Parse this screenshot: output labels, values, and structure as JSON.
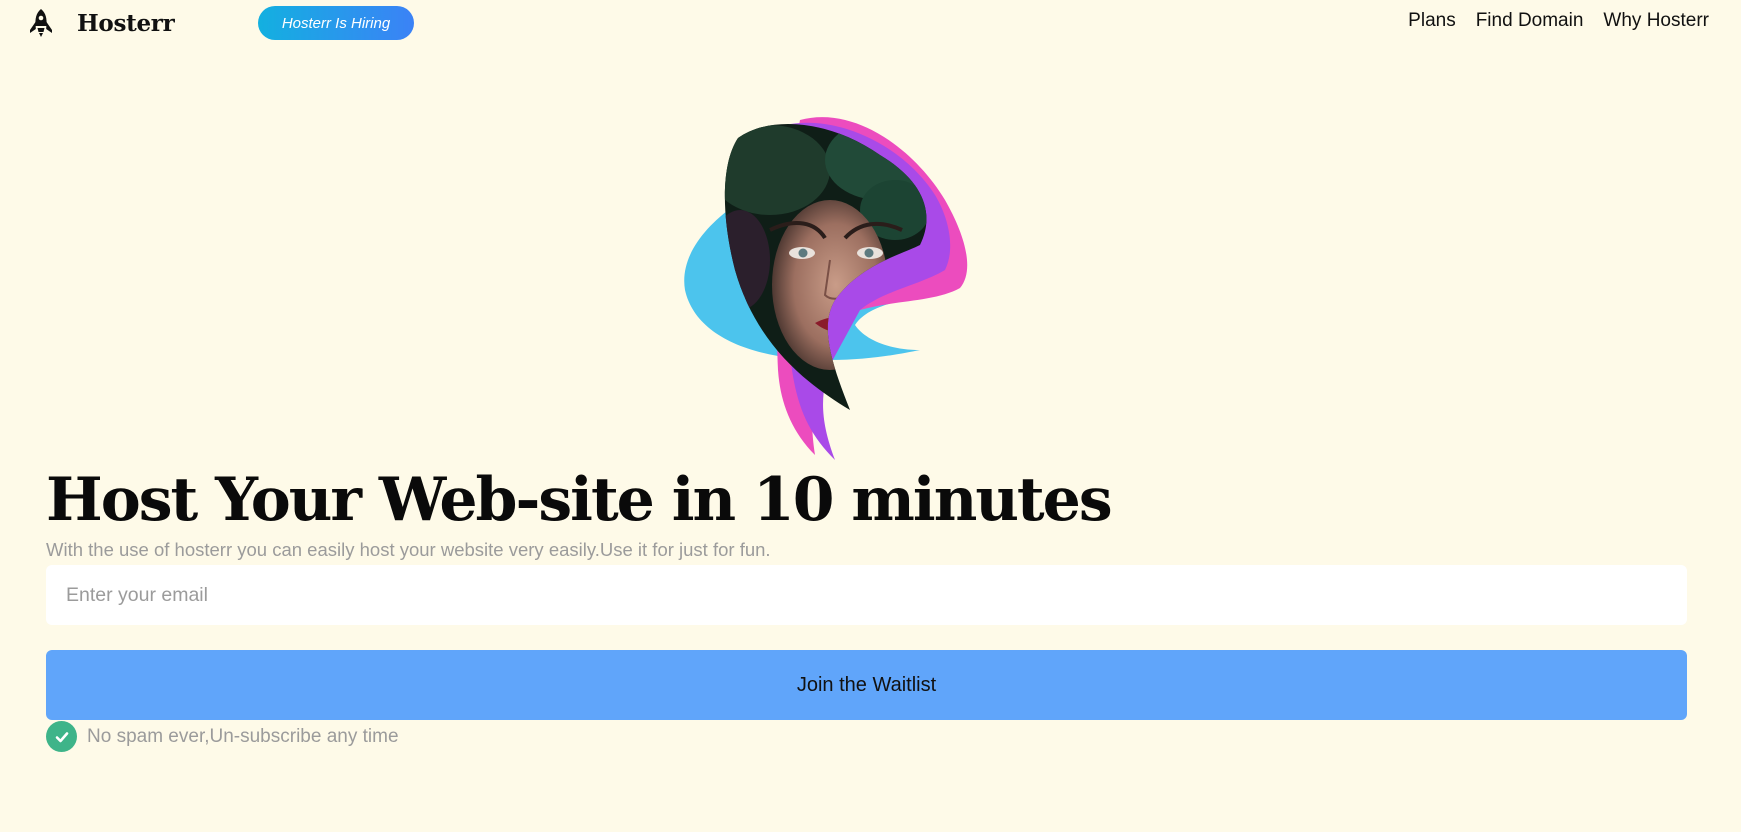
{
  "header": {
    "brand": "Hosterr",
    "hiring_label": "Hosterr Is Hiring",
    "nav": [
      {
        "label": "Plans"
      },
      {
        "label": "Find Domain"
      },
      {
        "label": "Why Hosterr"
      }
    ]
  },
  "hero": {
    "headline": "Host Your Web-site in 10 minutes",
    "subtext": "With the use of hosterr you can easily host your website very easily.Use it for just for fun.",
    "email_placeholder": "Enter your email",
    "email_value": "",
    "join_label": "Join the Waitlist",
    "nospam_text": "No spam ever,Un-subscribe any time"
  },
  "colors": {
    "background": "#fefae8",
    "button": "#60a5fa",
    "pill_gradient_start": "#13b0e0",
    "pill_gradient_end": "#3b82f6",
    "check": "#3eb489",
    "muted_text": "#9b9b9b"
  },
  "icons": {
    "logo": "rocket-icon",
    "check": "check-circle-icon"
  }
}
